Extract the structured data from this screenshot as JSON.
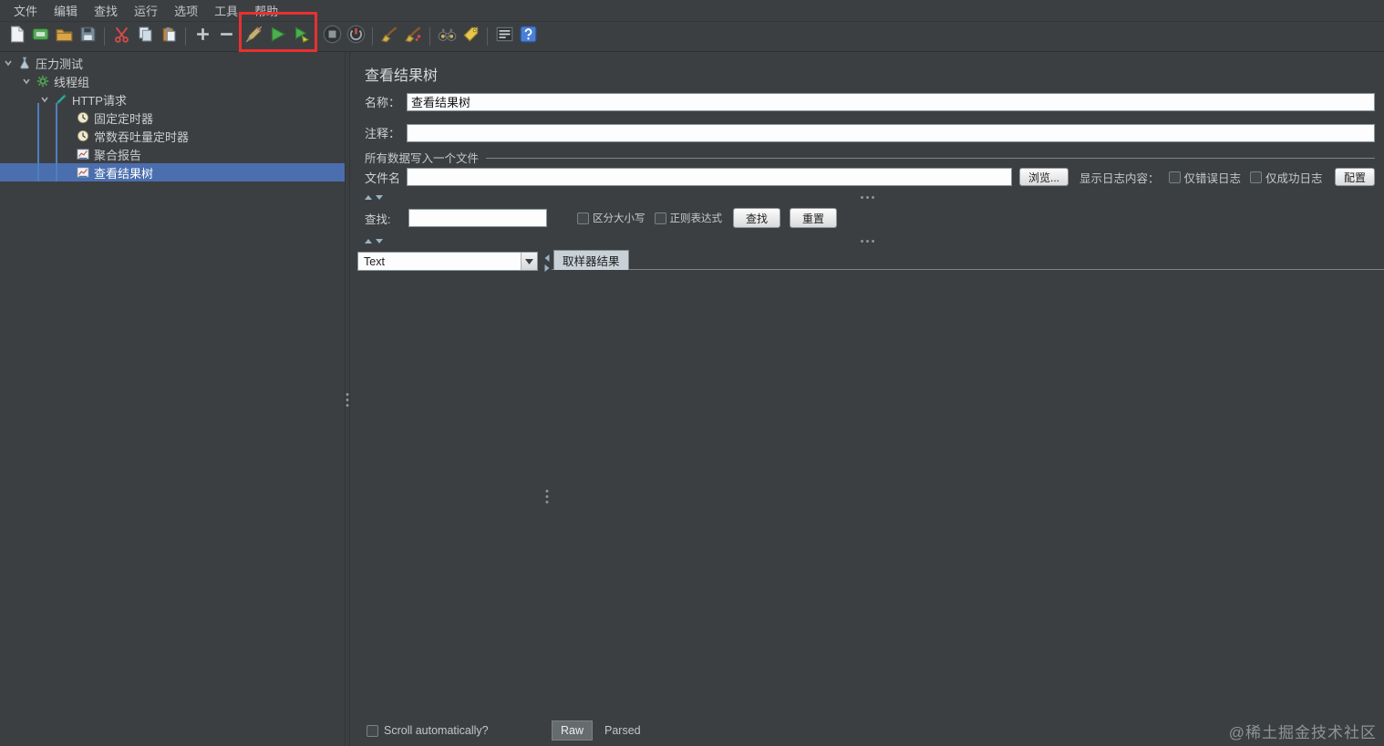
{
  "window": {
    "watermark": "@稀土掘金技术社区"
  },
  "colors": {
    "background": "#3c3f41",
    "selection": "#4b6eaf",
    "annotation_highlight": "#e93030",
    "input_bg": "#fdfdfd"
  },
  "menubar": {
    "items": [
      "文件",
      "编辑",
      "查找",
      "运行",
      "选项",
      "工具",
      "帮助"
    ]
  },
  "toolbar": {
    "icons": [
      "new-file-icon",
      "templates-icon",
      "open-icon",
      "save-icon",
      "cut-icon",
      "copy-icon",
      "paste-icon",
      "plus-icon",
      "minus-icon",
      "toggle-edit-icon",
      "start-icon",
      "start-no-pauses-icon",
      "stop-icon",
      "shutdown-icon",
      "clear-icon",
      "clear-all-icon",
      "search-icon",
      "function-helper-icon",
      "log-viewer-icon",
      "help-icon"
    ]
  },
  "tree": {
    "items": [
      {
        "label": "压力测试",
        "level": 0,
        "icon": "test-plan-icon",
        "expanded": true,
        "selected": false
      },
      {
        "label": "线程组",
        "level": 1,
        "icon": "thread-group-icon",
        "expanded": true,
        "selected": false
      },
      {
        "label": "HTTP请求",
        "level": 2,
        "icon": "http-request-icon",
        "expanded": true,
        "selected": false
      },
      {
        "label": "固定定时器",
        "level": 3,
        "icon": "timer-icon",
        "expanded": false,
        "selected": false
      },
      {
        "label": "常数吞吐量定时器",
        "level": 3,
        "icon": "timer-icon",
        "expanded": false,
        "selected": false
      },
      {
        "label": "聚合报告",
        "level": 3,
        "icon": "listener-icon",
        "expanded": false,
        "selected": false
      },
      {
        "label": "查看结果树",
        "level": 3,
        "icon": "listener-icon",
        "expanded": false,
        "selected": true
      }
    ]
  },
  "main": {
    "title": "查看结果树",
    "name_label": "名称：",
    "name_value": "查看结果树",
    "comment_label": "注释：",
    "comment_value": "",
    "file_section": {
      "title": "所有数据写入一个文件",
      "filename_label": "文件名",
      "filename_value": "",
      "browse_button": "浏览...",
      "log_display_label": "显示日志内容：",
      "errors_only": "仅错误日志",
      "success_only": "仅成功日志",
      "configure_button": "配置"
    },
    "search": {
      "label": "查找:",
      "value": "",
      "case_sensitive": "区分大小写",
      "regex": "正则表达式",
      "find_button": "查找",
      "reset_button": "重置"
    },
    "viewer": {
      "renderer_value": "Text",
      "scroll_label": "Scroll automatically?",
      "tab_sampler_result": "取样器结果",
      "tab_raw": "Raw",
      "tab_parsed": "Parsed"
    }
  }
}
